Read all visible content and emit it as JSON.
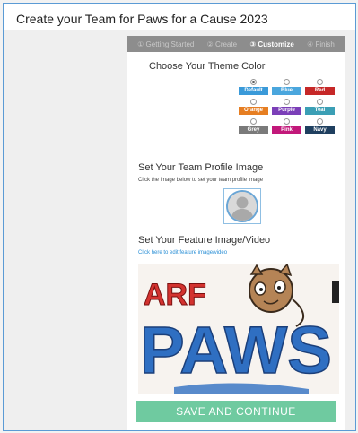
{
  "header": {
    "title": "Create your Team for Paws for a Cause 2023"
  },
  "steps": [
    {
      "label": "① Getting Started",
      "active": false
    },
    {
      "label": "② Create",
      "active": false
    },
    {
      "label": "③ Customize",
      "active": true
    },
    {
      "label": "④ Finish",
      "active": false
    }
  ],
  "theme": {
    "title": "Choose Your Theme Color",
    "selected": "Default",
    "colors": [
      {
        "label": "Default",
        "hex": "#3a9ad9"
      },
      {
        "label": "Blue",
        "hex": "#4aa6dd"
      },
      {
        "label": "Red",
        "hex": "#c62828"
      },
      {
        "label": "Orange",
        "hex": "#e67e22"
      },
      {
        "label": "Purple",
        "hex": "#7b3fb8"
      },
      {
        "label": "Teal",
        "hex": "#3b9fb5"
      },
      {
        "label": "Grey",
        "hex": "#7a7a7a"
      },
      {
        "label": "Pink",
        "hex": "#c2187a"
      },
      {
        "label": "Navy",
        "hex": "#1f3f5f"
      }
    ]
  },
  "profile": {
    "title": "Set Your Team Profile Image",
    "hint": "Click the image below to set your team profile image",
    "icon": "user-silhouette-icon"
  },
  "feature": {
    "title": "Set Your Feature Image/Video",
    "link": "Click here to edit feature image/video",
    "image_text_top": "ARF",
    "image_text_main": "PAWS"
  },
  "actions": {
    "save_label": "SAVE AND CONTINUE"
  },
  "colors": {
    "accent": "#6fcaa0",
    "frame_border": "#5b9bd5",
    "steps_bar": "#8d8d8d",
    "link": "#2a8fd6"
  }
}
